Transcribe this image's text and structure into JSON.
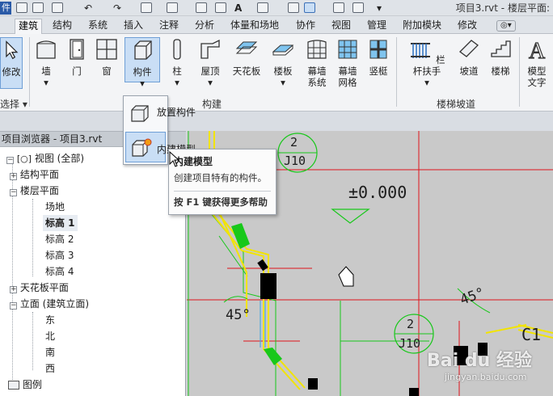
{
  "titlebar": {
    "app_tab": "件",
    "text_glyph": "A",
    "title": "项目3.rvt - 楼层平面:"
  },
  "tabs": [
    "建筑",
    "结构",
    "系统",
    "插入",
    "注释",
    "分析",
    "体量和场地",
    "协作",
    "视图",
    "管理",
    "附加模块",
    "修改"
  ],
  "active_tab": "建筑",
  "ribbon": {
    "select": {
      "label": "修改",
      "group": "选择"
    },
    "buttons": [
      {
        "label": "墙",
        "icon": "wall-icon"
      },
      {
        "label": "门",
        "icon": "door-icon"
      },
      {
        "label": "窗",
        "icon": "window-icon"
      },
      {
        "label": "构件",
        "icon": "component-icon",
        "pressed": true
      },
      {
        "label": "柱",
        "icon": "column-icon"
      },
      {
        "label": "屋顶",
        "icon": "roof-icon"
      },
      {
        "label": "天花板",
        "icon": "ceiling-icon"
      },
      {
        "label": "楼板",
        "icon": "floor-icon"
      },
      {
        "label": "幕墙",
        "label2": "系统",
        "icon": "curtain-system-icon"
      },
      {
        "label": "幕墙",
        "label2": "网格",
        "icon": "curtain-grid-icon"
      },
      {
        "label": "竖梃",
        "icon": "mullion-icon"
      },
      {
        "label": "栏杆扶手",
        "icon": "railing-icon"
      },
      {
        "label": "坡道",
        "icon": "ramp-icon"
      },
      {
        "label": "楼梯",
        "icon": "stair-icon"
      },
      {
        "label": "模型",
        "label2": "文字",
        "icon": "model-text-icon"
      }
    ],
    "groups": {
      "build": "构建",
      "circulation": "楼梯坡道"
    }
  },
  "component_menu": {
    "items": [
      {
        "label": "放置构件",
        "icon": "place-component-icon"
      },
      {
        "label": "内建模型",
        "icon": "in-place-model-icon"
      }
    ]
  },
  "tooltip": {
    "title": "内建模型",
    "description": "创建项目特有的构件。",
    "help": "按 F1 键获得更多帮助"
  },
  "project_browser": {
    "header": "项目浏览器 - 项目3.rvt",
    "nodes": [
      {
        "label": "视图 (全部)",
        "level": 0
      },
      {
        "label": "结构平面",
        "level": 1
      },
      {
        "label": "楼层平面",
        "level": 1
      },
      {
        "label": "场地",
        "level": 2
      },
      {
        "label": "标高 1",
        "level": 2,
        "selected": true
      },
      {
        "label": "标高 2",
        "level": 2
      },
      {
        "label": "标高 3",
        "level": 2
      },
      {
        "label": "标高 4",
        "level": 2
      },
      {
        "label": "天花板平面",
        "level": 1
      },
      {
        "label": "立面 (建筑立面)",
        "level": 1
      },
      {
        "label": "东",
        "level": 2
      },
      {
        "label": "北",
        "level": 2
      },
      {
        "label": "南",
        "level": 2
      },
      {
        "label": "西",
        "level": 2
      },
      {
        "label": "图例",
        "level": 0
      }
    ]
  },
  "drawing": {
    "section_top": {
      "number": "2",
      "sheet": "J10"
    },
    "section_bottom": {
      "number": "2",
      "sheet": "J10"
    },
    "elevation": "±0.000",
    "angle_left": "45°",
    "angle_right": "45°",
    "grid_label": "C1"
  },
  "watermark": {
    "brand": "Bai du 经验",
    "url": "jingyan.baidu.com"
  },
  "colors": {
    "accent": "#2a5aa7",
    "grid_red": "#e0141c",
    "wall_yellow": "#f2e400",
    "wall_green": "#18c81a"
  }
}
